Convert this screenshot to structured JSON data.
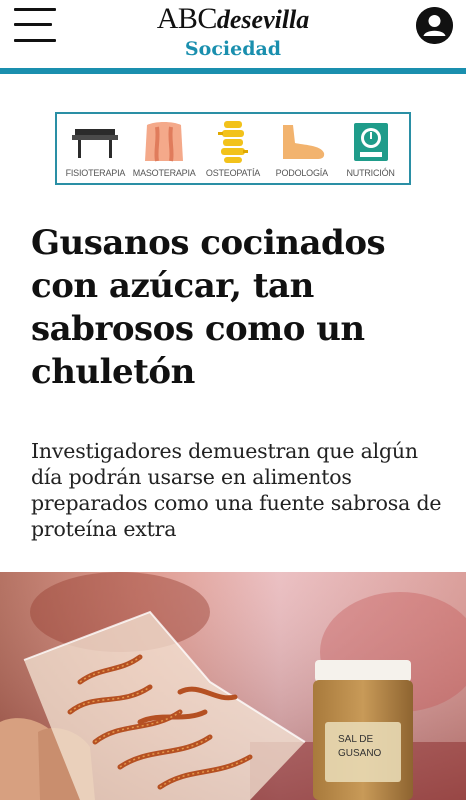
{
  "header": {
    "logo_main": "ABC",
    "logo_sub": "desevilla",
    "section": "Sociedad",
    "menu_icon": "hamburger-menu-icon",
    "user_icon": "user-account-icon",
    "accent_color": "#1a8fae"
  },
  "ad": {
    "items": [
      {
        "label": "FISIOTERAPIA",
        "icon": "massage-table-icon"
      },
      {
        "label": "MASOTERAPIA",
        "icon": "back-massage-icon"
      },
      {
        "label": "OSTEOPATÍA",
        "icon": "spine-icon"
      },
      {
        "label": "PODOLOGÍA",
        "icon": "foot-icon"
      },
      {
        "label": "NUTRICIÓN",
        "icon": "nutrition-scale-icon"
      }
    ]
  },
  "article": {
    "title": "Gusanos cocinados con azúcar, tan sabrosos como un chuletón",
    "subtitle": "Investigadores demuestran que algún día podrán usarse en alimentos preparados como una fuente sabrosa de proteína extra",
    "photo": {
      "jar_label_line1": "SAL DE",
      "jar_label_line2": "GUSANO"
    }
  }
}
